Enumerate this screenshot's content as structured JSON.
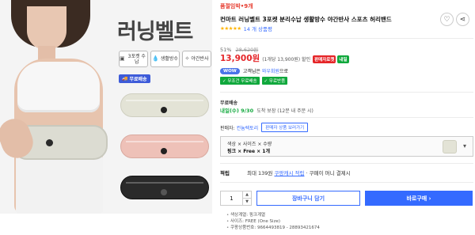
{
  "image": {
    "headline": "러닝벨트",
    "features": [
      {
        "icon": "cube-icon",
        "label": "3포켓 수납"
      },
      {
        "icon": "waterdrop-icon",
        "label": "생활방수"
      },
      {
        "icon": "reflect-icon",
        "label": "야간반사"
      }
    ],
    "ship_badge": "무료배송"
  },
  "product": {
    "brand_link": "품절임박•9개",
    "title": "컨마트 러닝벨트 3포켓 분리수납 생활방수 야간반사 스포츠 허리밴드",
    "stars": "★★★★★",
    "review_count": "14 개 상품평",
    "wish_icon": "heart-icon",
    "share_icon": "share-icon"
  },
  "price": {
    "discount_rate": "51%",
    "original_price": "28,620원",
    "sale_price": "13,900원",
    "unit_price": "(1개당 13,900원) 할인",
    "badge1": "판매자로켓",
    "badge2": "내일"
  },
  "wow": {
    "badge": "WOW",
    "text": "고객님은",
    "link": "와우회원",
    "suffix": "으로"
  },
  "benefits": [
    "✓ 무조건 무료배송",
    "✓ 무료반품"
  ],
  "shipping": {
    "title": "무료배송",
    "date": "내일(수) 9/30",
    "note": "도착 보장 (12분 내 주문 시)"
  },
  "seller": {
    "label": "판매자:",
    "name": "컨늄렉토리",
    "other_button": "판매자 상품 보러가기"
  },
  "option": {
    "line1": "색상 × 사이즈 × 수량",
    "line2": "핑크 × Free × 1개",
    "chevron_icon": "chevron-down-icon"
  },
  "points": {
    "label": "적립",
    "text_pre": "최대 139원",
    "cash": "쿠팡캐시 적립",
    "text_post": "· 쿠페이 머니 결제시"
  },
  "purchase": {
    "quantity": "1",
    "cart_label": "장바구니 담기",
    "buy_label": "바로구매 ›"
  },
  "specs": [
    "색상계열: 핑크계열",
    "사이즈: FREE (One Size)",
    "쿠팡상품번호: 9664493819 - 28893421674"
  ]
}
